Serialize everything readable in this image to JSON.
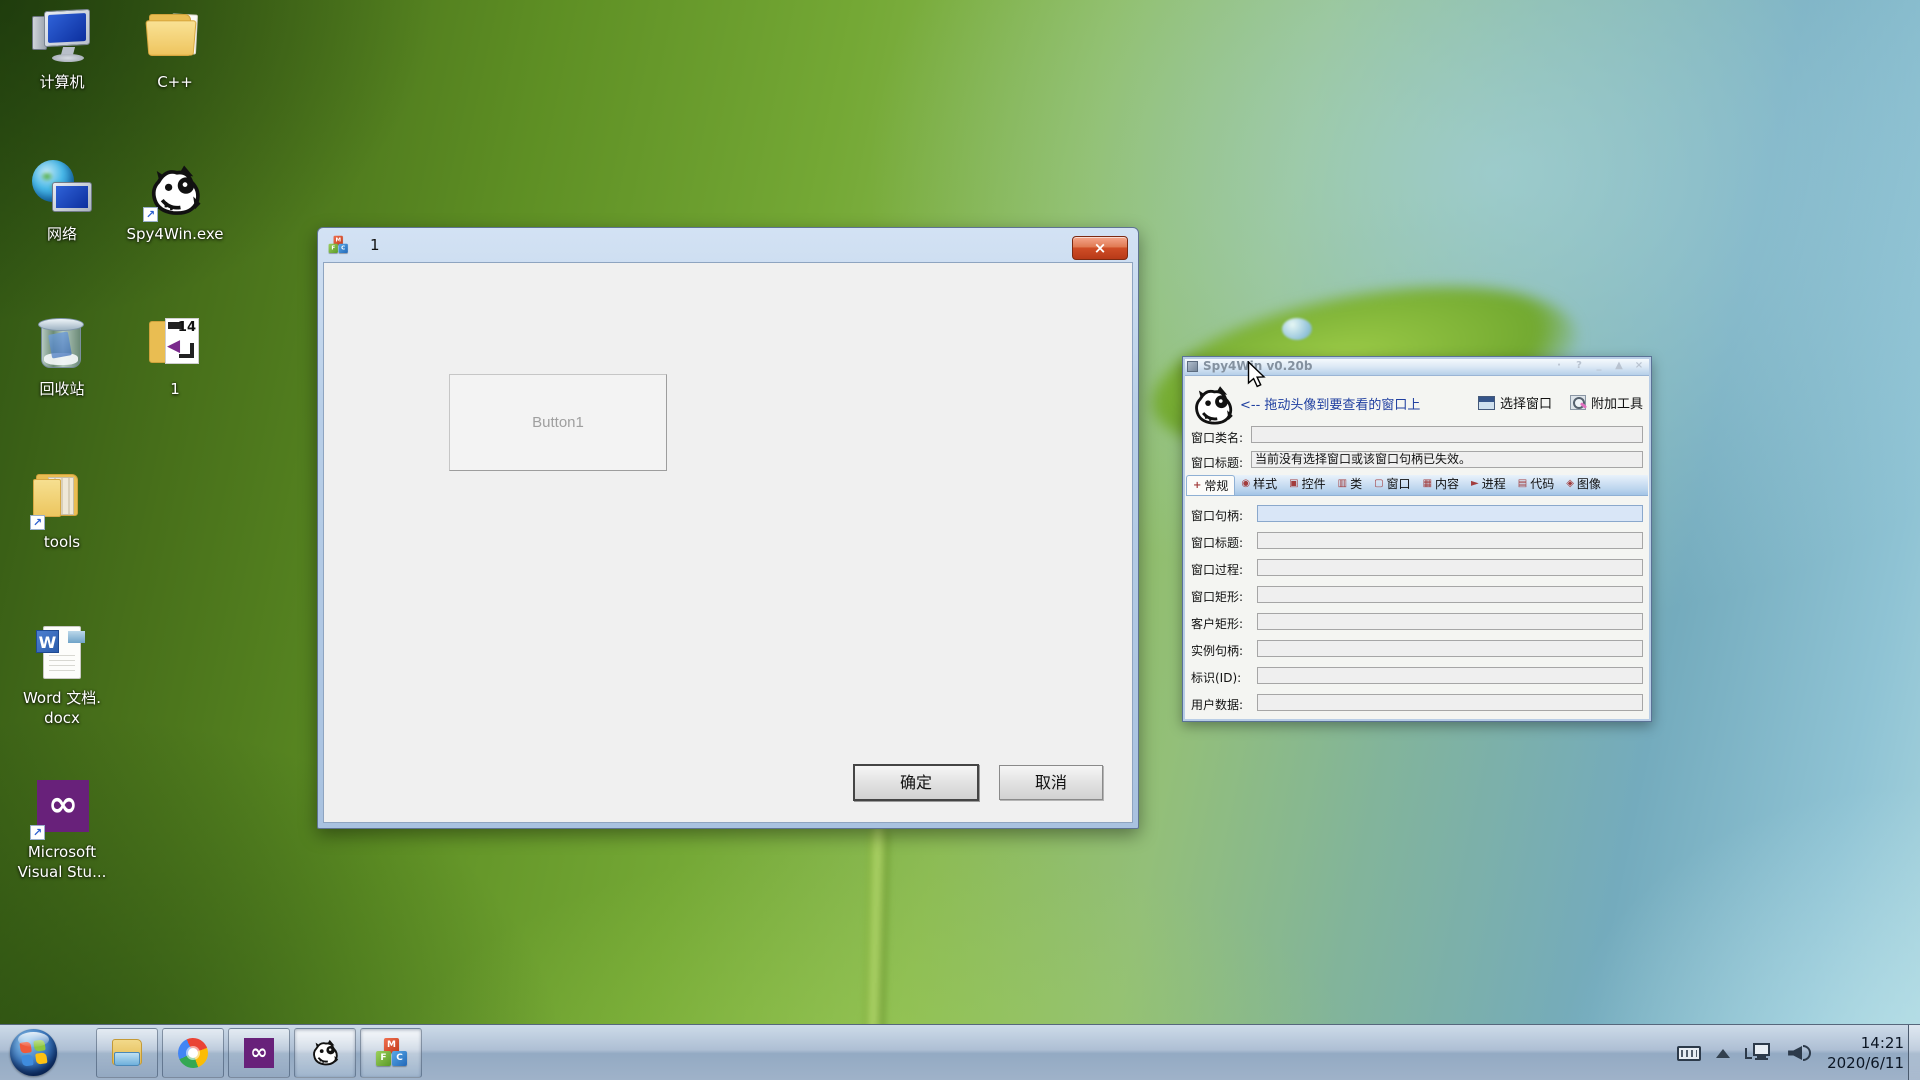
{
  "desktop": {
    "icons": [
      {
        "id": "computer",
        "icon": "computer-icon",
        "lines": [
          "计算机"
        ]
      },
      {
        "id": "cpp-folder",
        "icon": "folder-icon",
        "lines": [
          "C++"
        ]
      },
      {
        "id": "network",
        "icon": "network-icon",
        "lines": [
          "网络"
        ]
      },
      {
        "id": "spy4win-exe",
        "icon": "spy4win-dog-shortcut-icon",
        "lines": [
          "Spy4Win.exe"
        ]
      },
      {
        "id": "recycle-bin",
        "icon": "recycle-bin-icon",
        "lines": [
          "回收站"
        ]
      },
      {
        "id": "folder-1",
        "icon": "vs-project-folder-icon",
        "lines": [
          "1"
        ]
      },
      {
        "id": "tools-folder",
        "icon": "folder-shortcut-icon",
        "lines": [
          "tools"
        ]
      },
      {
        "id": "word-doc",
        "icon": "word-doc-icon",
        "lines": [
          "Word 文档.",
          "docx"
        ]
      },
      {
        "id": "visual-studio",
        "icon": "visual-studio-shortcut-icon",
        "lines": [
          "Microsoft",
          "Visual Stu..."
        ]
      }
    ]
  },
  "dialog": {
    "title": "1",
    "close_glyph": "×",
    "button1": "Button1",
    "ok": "确定",
    "cancel": "取消"
  },
  "spy4win": {
    "title": "Spy4Win v0.20b",
    "titlebar_buttons": [
      {
        "id": "pin",
        "glyph": "·"
      },
      {
        "id": "help",
        "glyph": "?"
      },
      {
        "id": "minimize",
        "glyph": "_"
      },
      {
        "id": "rollup",
        "glyph": "▲"
      },
      {
        "id": "close",
        "glyph": "×"
      }
    ],
    "hint": "<-- 拖动头像到要查看的窗口上",
    "select_window": "选择窗口",
    "attach_tools": "附加工具",
    "class_label": "窗口类名:",
    "class_value": "",
    "caption_label": "窗口标题:",
    "caption_value": "当前没有选择窗口或该窗口句柄已失效。",
    "tabs": [
      {
        "label": "常规",
        "glyph": "+",
        "selected": true
      },
      {
        "label": "样式",
        "glyph": "◉",
        "selected": false
      },
      {
        "label": "控件",
        "glyph": "▣",
        "selected": false
      },
      {
        "label": "类",
        "glyph": "▥",
        "selected": false
      },
      {
        "label": "窗口",
        "glyph": "▢",
        "selected": false
      },
      {
        "label": "内容",
        "glyph": "▦",
        "selected": false
      },
      {
        "label": "进程",
        "glyph": "►",
        "selected": false
      },
      {
        "label": "代码",
        "glyph": "▤",
        "selected": false
      },
      {
        "label": "图像",
        "glyph": "◈",
        "selected": false
      }
    ],
    "fields": [
      {
        "label": "窗口句柄:",
        "value": "",
        "focused": true
      },
      {
        "label": "窗口标题:",
        "value": "",
        "focused": false
      },
      {
        "label": "窗口过程:",
        "value": "",
        "focused": false
      },
      {
        "label": "窗口矩形:",
        "value": "",
        "focused": false
      },
      {
        "label": "客户矩形:",
        "value": "",
        "focused": false
      },
      {
        "label": "实例句柄:",
        "value": "",
        "focused": false
      },
      {
        "label": "标识(ID):",
        "value": "",
        "focused": false
      },
      {
        "label": "用户数据:",
        "value": "",
        "focused": false
      }
    ]
  },
  "taskbar": {
    "buttons": [
      {
        "id": "explorer",
        "active": false
      },
      {
        "id": "chrome",
        "active": false
      },
      {
        "id": "visual-studio",
        "active": false
      },
      {
        "id": "spy4win",
        "active": true
      },
      {
        "id": "mfc-app",
        "active": true
      }
    ],
    "clock_time": "14:21",
    "clock_date": "2020/6/11"
  },
  "colors": {
    "close_button_red": "#cf4d26",
    "desktop_green": "#5e8f24",
    "taskbar_blue": "#aebfd4",
    "focused_field_blue": "#d9e6f7",
    "hint_navy": "#2040a0"
  }
}
